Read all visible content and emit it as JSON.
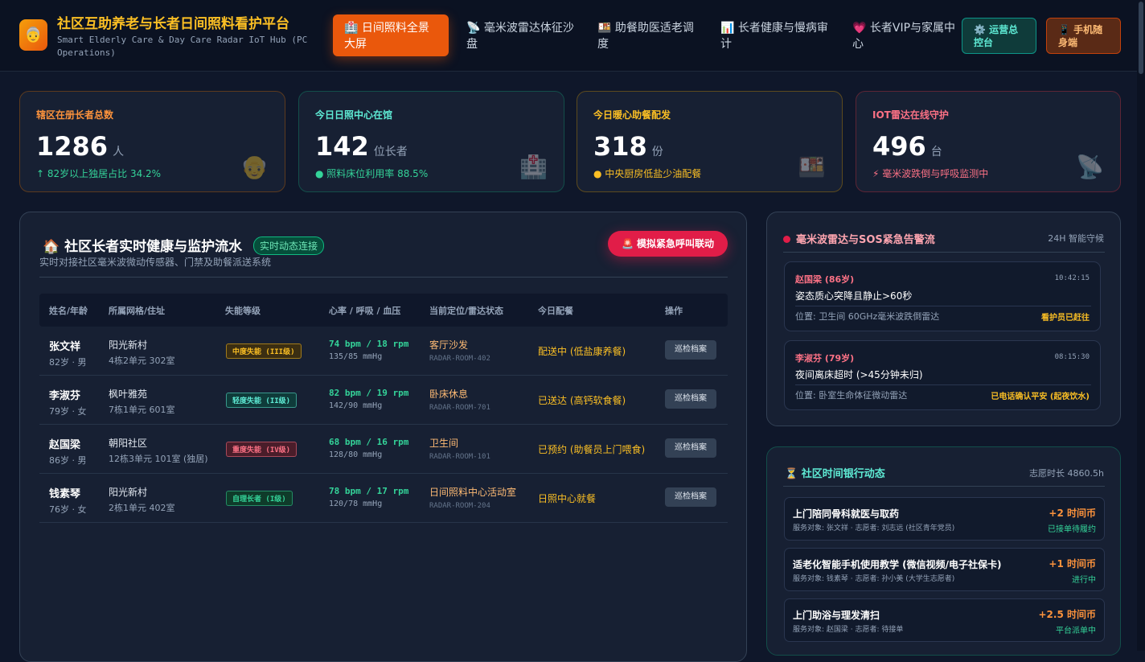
{
  "brand": {
    "logo_glyph": "👵",
    "title": "社区互助养老与长者日间照料看护平台",
    "subtitle": "Smart Elderly Care & Day Care Radar IoT Hub (PC Operations)"
  },
  "nav": [
    {
      "icon": "🏥",
      "label": "日间照料全景大屏",
      "active": true
    },
    {
      "icon": "📡",
      "label": "毫米波雷达体征沙盘",
      "active": false
    },
    {
      "icon": "🍱",
      "label": "助餐助医适老调度",
      "active": false
    },
    {
      "icon": "📊",
      "label": "长者健康与慢病审计",
      "active": false
    },
    {
      "icon": "💗",
      "label": "长者VIP与家属中心",
      "active": false
    }
  ],
  "header_buttons": {
    "ops": "⚙️ 运营总控台",
    "mobile": "📱 手机随身端"
  },
  "stats": [
    {
      "label": "辖区在册长者总数",
      "value": "1286",
      "unit": "人",
      "foot": "↑ 82岁以上独居占比 34.2%",
      "deco": "👴",
      "accent": "#fb923c",
      "foot_color": "#34d399",
      "border": "#5c3a1e"
    },
    {
      "label": "今日日照中心在馆",
      "value": "142",
      "unit": "位长者",
      "foot": "● 照料床位利用率 88.5%",
      "deco": "🏥",
      "accent": "#5eead4",
      "foot_color": "#34d399",
      "border": "#134e4a"
    },
    {
      "label": "今日暖心助餐配发",
      "value": "318",
      "unit": "份",
      "foot": "● 中央厨房低盐少油配餐",
      "deco": "🍱",
      "accent": "#fbbf24",
      "foot_color": "#fbbf24",
      "border": "#5c4a1e"
    },
    {
      "label": "IOT雷达在线守护",
      "value": "496",
      "unit": "台",
      "foot": "⚡ 毫米波跌倒与呼吸监测中",
      "deco": "📡",
      "accent": "#fb7185",
      "foot_color": "#fb7185",
      "border": "#5c2535"
    }
  ],
  "monitor": {
    "icon": "🏠",
    "title": "社区长者实时健康与监护流水",
    "badge": "实时动态连接",
    "subtitle": "实时对接社区毫米波微动传感器、门禁及助餐派送系统",
    "sos_button": "🚨 模拟紧急呼叫联动",
    "columns": [
      "姓名/年龄",
      "所属网格/住址",
      "失能等级",
      "心率 / 呼吸 / 血压",
      "当前定位/雷达状态",
      "今日配餐",
      "操作"
    ],
    "rows": [
      {
        "name": "张文祥",
        "age": "82岁 · 男",
        "community": "阳光新村",
        "address": "4栋2单元 302室",
        "level": "中度失能 (III级)",
        "level_color": "#fbbf24",
        "level_bg": "#3b2e12",
        "vitals": "74 bpm / 18 rpm",
        "bp": "135/85 mmHg",
        "location": "客厅沙发",
        "radar": "RADAR-ROOM-402",
        "meal": "配送中 (低盐康养餐)",
        "action": "巡检档案"
      },
      {
        "name": "李淑芬",
        "age": "79岁 · 女",
        "community": "枫叶雅苑",
        "address": "7栋1单元 601室",
        "level": "轻度失能 (II级)",
        "level_color": "#5eead4",
        "level_bg": "#0f3b3a",
        "vitals": "82 bpm / 19 rpm",
        "bp": "142/90 mmHg",
        "location": "卧床休息",
        "radar": "RADAR-ROOM-701",
        "meal": "已送达 (高钙软食餐)",
        "action": "巡检档案"
      },
      {
        "name": "赵国梁",
        "age": "86岁 · 男",
        "community": "朝阳社区",
        "address": "12栋3单元 101室 (独居)",
        "level": "重度失能 (IV级)",
        "level_color": "#fb7185",
        "level_bg": "#4a1d2a",
        "vitals": "68 bpm / 16 rpm",
        "bp": "128/80 mmHg",
        "location": "卫生间",
        "radar": "RADAR-ROOM-101",
        "meal": "已预约 (助餐员上门喂食)",
        "action": "巡检档案"
      },
      {
        "name": "钱素琴",
        "age": "76岁 · 女",
        "community": "阳光新村",
        "address": "2栋1单元 402室",
        "level": "自理长者 (I级)",
        "level_color": "#34d399",
        "level_bg": "#0f3b2a",
        "vitals": "78 bpm / 17 rpm",
        "bp": "120/78 mmHg",
        "location": "日间照料中心活动室",
        "radar": "RADAR-ROOM-204",
        "meal": "日照中心就餐",
        "action": "巡检档案"
      }
    ]
  },
  "alerts": {
    "title": "毫米波雷达与SOS紧急告警流",
    "meta": "24H 智能守候",
    "items": [
      {
        "who": "赵国梁 (86岁)",
        "time": "10:42:15",
        "msg": "姿态质心突降且静止>60秒",
        "pos": "位置: 卫生间 60GHz毫米波跌倒雷达",
        "status": "看护员已赶往"
      },
      {
        "who": "李淑芬 (79岁)",
        "time": "08:15:30",
        "msg": "夜间离床超时 (>45分钟未归)",
        "pos": "位置: 卧室生命体征微动雷达",
        "status": "已电话确认平安 (起夜饮水)"
      }
    ]
  },
  "timebank": {
    "title": "⏳ 社区时间银行动态",
    "meta": "志愿时长 4860.5h",
    "items": [
      {
        "title": "上门陪同骨科就医与取药",
        "detail": "服务对象: 张文祥 · 志愿者: 刘志远 (社区青年党员)",
        "coin": "+2 时间币",
        "progress": "已接单待履约"
      },
      {
        "title": "适老化智能手机使用教学 (微信视频/电子社保卡)",
        "detail": "服务对象: 钱素琴 · 志愿者: 孙小美 (大学生志愿者)",
        "coin": "+1 时间币",
        "progress": "进行中"
      },
      {
        "title": "上门助浴与理发清扫",
        "detail": "服务对象: 赵国梁 · 志愿者: 待接单",
        "coin": "+2.5 时间币",
        "progress": "平台派单中"
      }
    ]
  }
}
